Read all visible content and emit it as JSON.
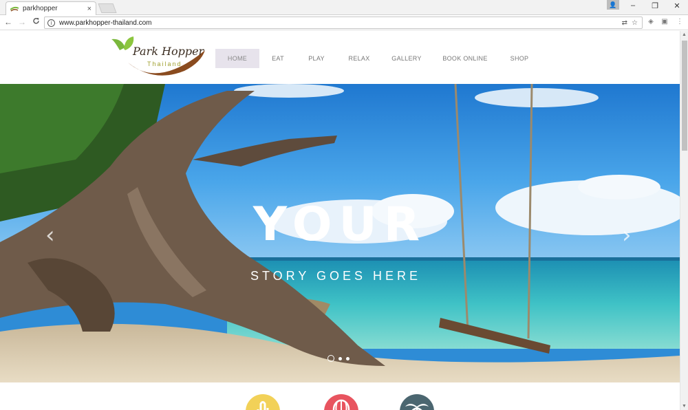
{
  "browser": {
    "tab_title": "parkhopper",
    "tab_close": "×",
    "url": "www.parkhopper-thailand.com",
    "window_controls": [
      "–",
      "❐",
      "✕"
    ],
    "nav_buttons": [
      "←",
      "→",
      "C"
    ]
  },
  "site": {
    "logo_title": "Park Hopper",
    "logo_subtitle": "Thailand",
    "nav": [
      "HOME",
      "EAT",
      "PLAY",
      "RELAX",
      "GALLERY",
      "BOOK ONLINE",
      "SHOP"
    ],
    "active_nav": "HOME"
  },
  "hero": {
    "title": "YOUR",
    "subtitle": "STORY GOES HERE",
    "prev_arrow": "‹",
    "next_arrow": "›",
    "slides": 3,
    "active_slide": 1
  },
  "features": [
    {
      "icon": "cactus-icon",
      "color": "#f2d158"
    },
    {
      "icon": "hot-air-balloon-icon",
      "color": "#e8545f"
    },
    {
      "icon": "palm-tree-icon",
      "color": "#4b6670"
    }
  ],
  "colors": {
    "logo_leaf": "#7ab83c",
    "logo_swoosh": "#8a4b1f",
    "nav_active_bg": "#e7e3ec"
  }
}
